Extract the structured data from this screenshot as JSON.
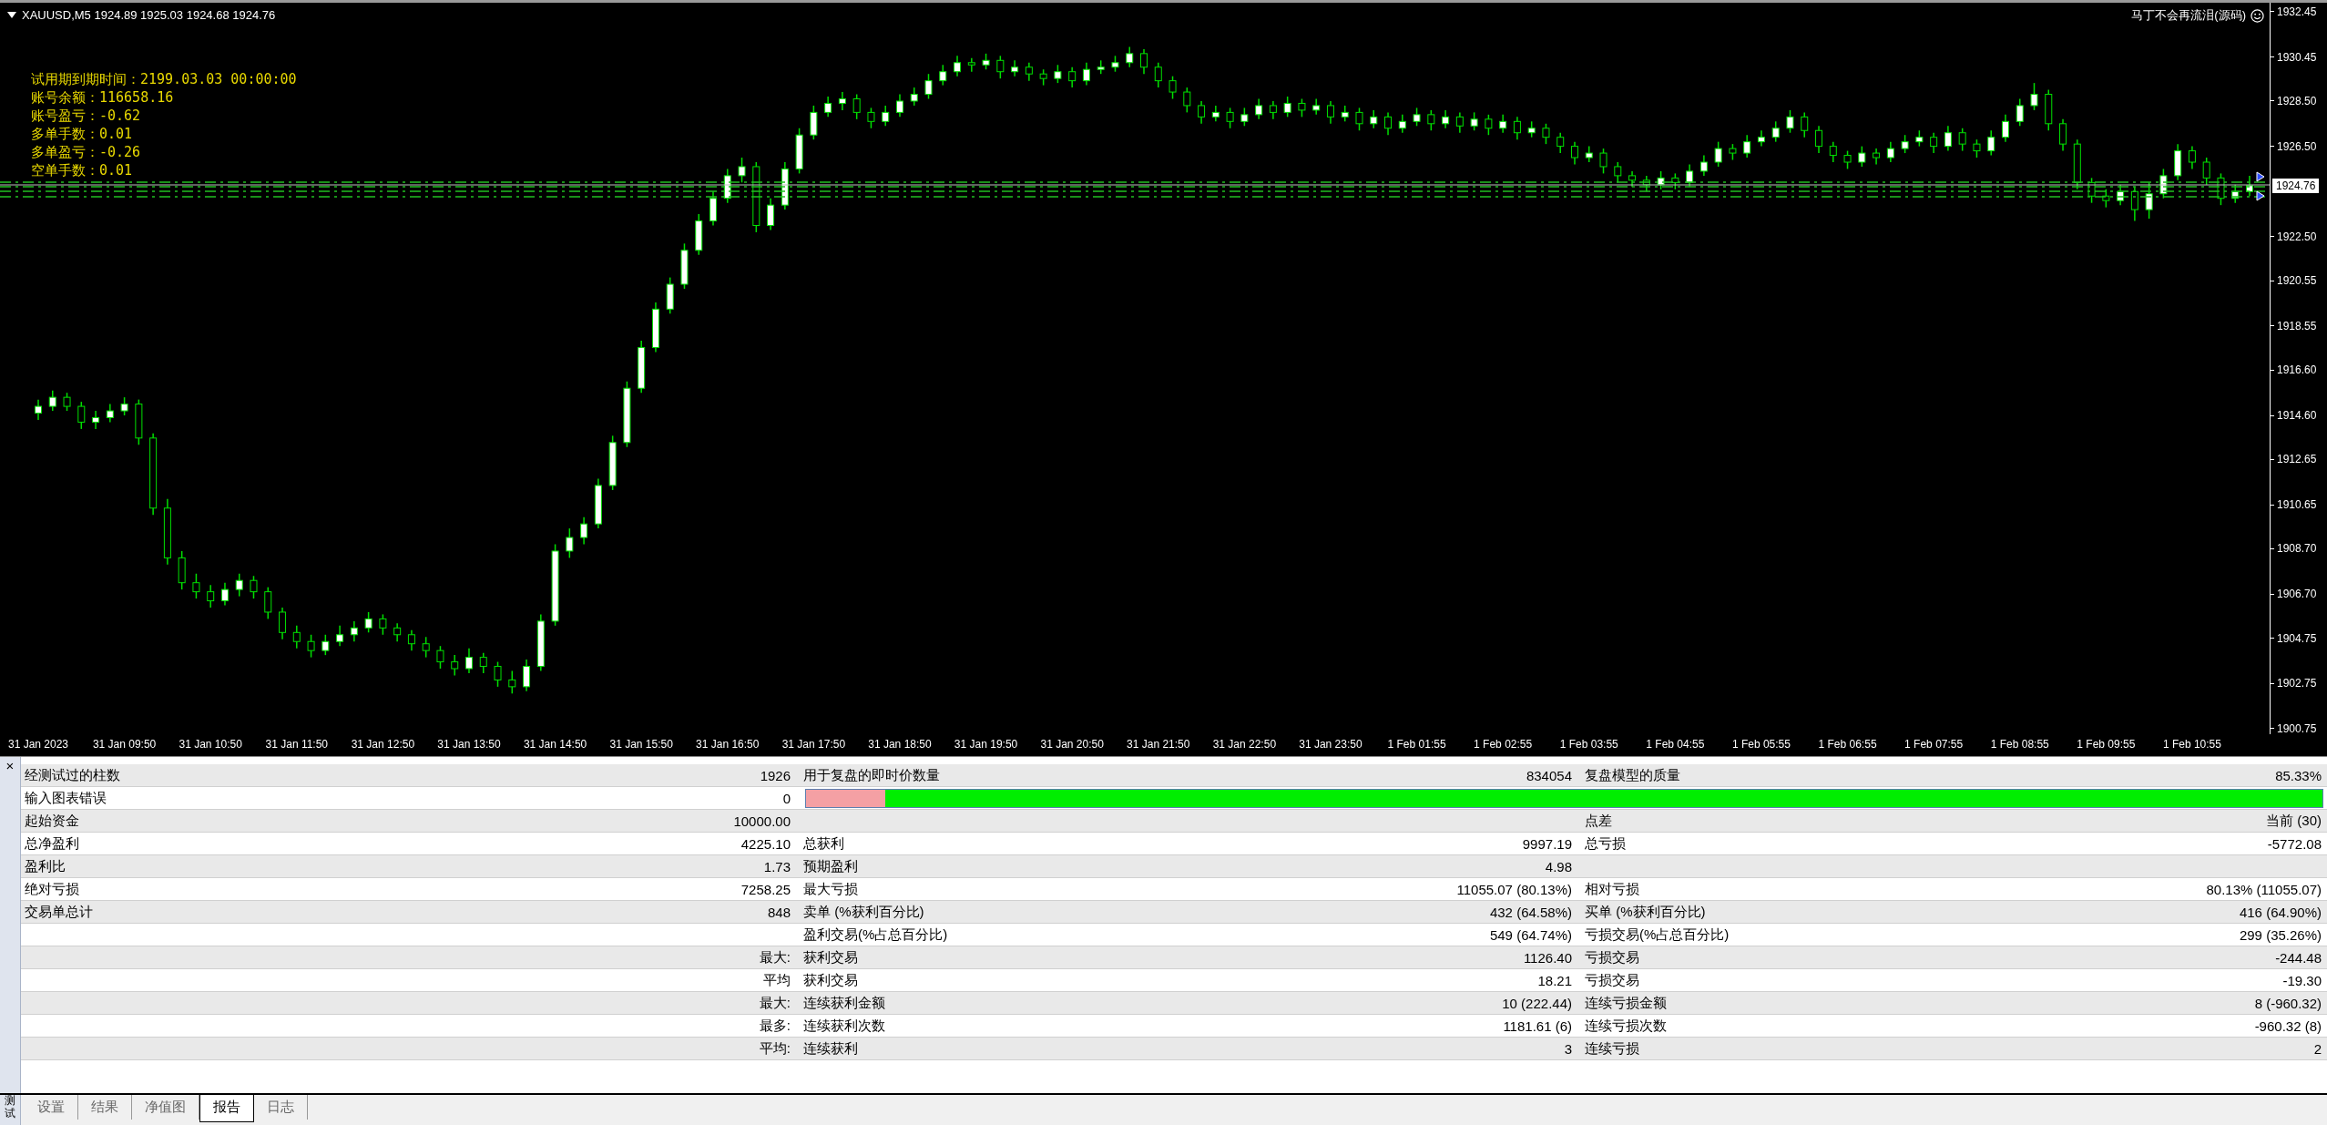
{
  "chart": {
    "symbol_info": "XAUUSD,M5  1924.89 1925.03 1924.68 1924.76",
    "indicator_title": "马丁不会再流泪(源码)",
    "info_lines": [
      "试用期到期时间：2199.03.03 00:00:00",
      "账号余额：116658.16",
      "账号盈亏：-0.62",
      "多单手数：0.01",
      "多单盈亏：-0.26",
      "空单手数：0.01"
    ],
    "current_price": "1924.76",
    "chart_data": {
      "type": "candlestick",
      "categories": [
        "31 Jan 2023",
        null,
        null,
        null,
        null,
        null,
        "31 Jan 09:50",
        null,
        null,
        null,
        null,
        null,
        "31 Jan 10:50",
        null,
        null,
        null,
        null,
        null,
        "31 Jan 11:50",
        null,
        null,
        null,
        null,
        null,
        "31 Jan 12:50",
        null,
        null,
        null,
        null,
        null,
        "31 Jan 13:50",
        null,
        null,
        null,
        null,
        null,
        "31 Jan 14:50",
        null,
        null,
        null,
        null,
        null,
        "31 Jan 15:50",
        null,
        null,
        null,
        null,
        null,
        "31 Jan 16:50",
        null,
        null,
        null,
        null,
        null,
        "31 Jan 17:50",
        null,
        null,
        null,
        null,
        null,
        "31 Jan 18:50",
        null,
        null,
        null,
        null,
        null,
        "31 Jan 19:50",
        null,
        null,
        null,
        null,
        null,
        "31 Jan 20:50",
        null,
        null,
        null,
        null,
        null,
        "31 Jan 21:50",
        null,
        null,
        null,
        null,
        null,
        "31 Jan 22:50",
        null,
        null,
        null,
        null,
        null,
        "31 Jan 23:50",
        null,
        null,
        null,
        null,
        null,
        "1 Feb 01:55",
        null,
        null,
        null,
        null,
        null,
        "1 Feb 02:55",
        null,
        null,
        null,
        null,
        null,
        "1 Feb 03:55",
        null,
        null,
        null,
        null,
        null,
        "1 Feb 04:55",
        null,
        null,
        null,
        null,
        null,
        "1 Feb 05:55",
        null,
        null,
        null,
        null,
        null,
        "1 Feb 06:55",
        null,
        null,
        null,
        null,
        null,
        "1 Feb 07:55",
        null,
        null,
        null,
        null,
        null,
        "1 Feb 08:55",
        null,
        null,
        null,
        null,
        null,
        "1 Feb 09:55",
        null,
        null,
        null,
        null,
        null,
        "1 Feb 10:55",
        null,
        null,
        null,
        null
      ],
      "ohlc": [
        [
          1914.7,
          1915.3,
          1914.4,
          1915.0
        ],
        [
          1915.0,
          1915.7,
          1914.8,
          1915.4
        ],
        [
          1915.4,
          1915.6,
          1914.8,
          1915.0
        ],
        [
          1915.0,
          1915.2,
          1914.0,
          1914.3
        ],
        [
          1914.3,
          1914.8,
          1914.0,
          1914.5
        ],
        [
          1914.5,
          1915.1,
          1914.3,
          1914.8
        ],
        [
          1914.8,
          1915.4,
          1914.6,
          1915.1
        ],
        [
          1915.1,
          1915.3,
          1913.3,
          1913.6
        ],
        [
          1913.6,
          1913.8,
          1910.2,
          1910.5
        ],
        [
          1910.5,
          1910.9,
          1908.0,
          1908.3
        ],
        [
          1908.3,
          1908.6,
          1906.9,
          1907.2
        ],
        [
          1907.2,
          1907.6,
          1906.5,
          1906.8
        ],
        [
          1906.8,
          1907.1,
          1906.1,
          1906.4
        ],
        [
          1906.4,
          1907.2,
          1906.2,
          1906.9
        ],
        [
          1906.9,
          1907.6,
          1906.6,
          1907.3
        ],
        [
          1907.3,
          1907.5,
          1906.5,
          1906.8
        ],
        [
          1906.8,
          1907.0,
          1905.6,
          1905.9
        ],
        [
          1905.9,
          1906.1,
          1904.7,
          1905.0
        ],
        [
          1905.0,
          1905.3,
          1904.3,
          1904.6
        ],
        [
          1904.6,
          1904.9,
          1903.9,
          1904.2
        ],
        [
          1904.2,
          1904.9,
          1904.0,
          1904.6
        ],
        [
          1904.6,
          1905.3,
          1904.4,
          1904.9
        ],
        [
          1904.9,
          1905.5,
          1904.6,
          1905.2
        ],
        [
          1905.2,
          1905.9,
          1905.0,
          1905.6
        ],
        [
          1905.6,
          1905.8,
          1904.9,
          1905.2
        ],
        [
          1905.2,
          1905.4,
          1904.6,
          1904.9
        ],
        [
          1904.9,
          1905.1,
          1904.2,
          1904.5
        ],
        [
          1904.5,
          1904.8,
          1903.9,
          1904.2
        ],
        [
          1904.2,
          1904.4,
          1903.4,
          1903.7
        ],
        [
          1903.7,
          1904.0,
          1903.1,
          1903.4
        ],
        [
          1903.4,
          1904.3,
          1903.2,
          1903.9
        ],
        [
          1903.9,
          1904.1,
          1903.2,
          1903.5
        ],
        [
          1903.5,
          1903.7,
          1902.6,
          1902.9
        ],
        [
          1902.9,
          1903.3,
          1902.3,
          1902.6
        ],
        [
          1902.6,
          1903.8,
          1902.4,
          1903.5
        ],
        [
          1903.5,
          1905.8,
          1903.3,
          1905.5
        ],
        [
          1905.5,
          1908.9,
          1905.3,
          1908.6
        ],
        [
          1908.6,
          1909.6,
          1908.3,
          1909.2
        ],
        [
          1909.2,
          1910.1,
          1908.9,
          1909.8
        ],
        [
          1909.8,
          1911.8,
          1909.6,
          1911.5
        ],
        [
          1911.5,
          1913.7,
          1911.3,
          1913.4
        ],
        [
          1913.4,
          1916.1,
          1913.2,
          1915.8
        ],
        [
          1915.8,
          1917.9,
          1915.6,
          1917.6
        ],
        [
          1917.6,
          1919.6,
          1917.4,
          1919.3
        ],
        [
          1919.3,
          1920.7,
          1919.1,
          1920.4
        ],
        [
          1920.4,
          1922.2,
          1920.2,
          1921.9
        ],
        [
          1921.9,
          1923.5,
          1921.7,
          1923.2
        ],
        [
          1923.2,
          1924.5,
          1923.0,
          1924.2
        ],
        [
          1924.2,
          1925.5,
          1924.0,
          1925.2
        ],
        [
          1925.2,
          1926.0,
          1924.9,
          1925.6
        ],
        [
          1925.6,
          1925.8,
          1922.7,
          1923.0
        ],
        [
          1923.0,
          1924.2,
          1922.8,
          1923.9
        ],
        [
          1923.9,
          1925.8,
          1923.7,
          1925.5
        ],
        [
          1925.5,
          1927.3,
          1925.3,
          1927.0
        ],
        [
          1927.0,
          1928.3,
          1926.8,
          1928.0
        ],
        [
          1928.0,
          1928.7,
          1927.8,
          1928.4
        ],
        [
          1928.4,
          1928.9,
          1928.1,
          1928.6
        ],
        [
          1928.6,
          1928.8,
          1927.7,
          1928.0
        ],
        [
          1928.0,
          1928.2,
          1927.3,
          1927.6
        ],
        [
          1927.6,
          1928.3,
          1927.4,
          1928.0
        ],
        [
          1928.0,
          1928.8,
          1927.8,
          1928.5
        ],
        [
          1928.5,
          1929.1,
          1928.3,
          1928.8
        ],
        [
          1928.8,
          1929.7,
          1928.6,
          1929.4
        ],
        [
          1929.4,
          1930.1,
          1929.2,
          1929.8
        ],
        [
          1929.8,
          1930.5,
          1929.6,
          1930.2
        ],
        [
          1930.2,
          1930.4,
          1929.8,
          1930.1
        ],
        [
          1930.1,
          1930.6,
          1929.9,
          1930.3
        ],
        [
          1930.3,
          1930.5,
          1929.5,
          1929.8
        ],
        [
          1929.8,
          1930.3,
          1929.6,
          1930.0
        ],
        [
          1930.0,
          1930.2,
          1929.4,
          1929.7
        ],
        [
          1929.7,
          1929.9,
          1929.2,
          1929.5
        ],
        [
          1929.5,
          1930.1,
          1929.3,
          1929.8
        ],
        [
          1929.8,
          1930.0,
          1929.1,
          1929.4
        ],
        [
          1929.4,
          1930.2,
          1929.2,
          1929.9
        ],
        [
          1929.9,
          1930.3,
          1929.7,
          1930.0
        ],
        [
          1930.0,
          1930.5,
          1929.8,
          1930.2
        ],
        [
          1930.2,
          1930.9,
          1930.0,
          1930.6
        ],
        [
          1930.6,
          1930.8,
          1929.7,
          1930.0
        ],
        [
          1930.0,
          1930.2,
          1929.1,
          1929.4
        ],
        [
          1929.4,
          1929.6,
          1928.6,
          1928.9
        ],
        [
          1928.9,
          1929.1,
          1928.0,
          1928.3
        ],
        [
          1928.3,
          1928.5,
          1927.5,
          1927.8
        ],
        [
          1927.8,
          1928.3,
          1927.6,
          1928.0
        ],
        [
          1928.0,
          1928.2,
          1927.3,
          1927.6
        ],
        [
          1927.6,
          1928.2,
          1927.4,
          1927.9
        ],
        [
          1927.9,
          1928.6,
          1927.7,
          1928.3
        ],
        [
          1928.3,
          1928.5,
          1927.7,
          1928.0
        ],
        [
          1928.0,
          1928.7,
          1927.8,
          1928.4
        ],
        [
          1928.4,
          1928.6,
          1927.8,
          1928.1
        ],
        [
          1928.1,
          1928.6,
          1927.9,
          1928.3
        ],
        [
          1928.3,
          1928.5,
          1927.5,
          1927.8
        ],
        [
          1927.8,
          1928.3,
          1927.6,
          1928.0
        ],
        [
          1928.0,
          1928.2,
          1927.2,
          1927.5
        ],
        [
          1927.5,
          1928.1,
          1927.3,
          1927.8
        ],
        [
          1927.8,
          1928.0,
          1927.0,
          1927.3
        ],
        [
          1927.3,
          1927.9,
          1927.1,
          1927.6
        ],
        [
          1927.6,
          1928.2,
          1927.4,
          1927.9
        ],
        [
          1927.9,
          1928.1,
          1927.2,
          1927.5
        ],
        [
          1927.5,
          1928.1,
          1927.3,
          1927.8
        ],
        [
          1927.8,
          1928.0,
          1927.1,
          1927.4
        ],
        [
          1927.4,
          1928.0,
          1927.2,
          1927.7
        ],
        [
          1927.7,
          1927.9,
          1927.0,
          1927.3
        ],
        [
          1927.3,
          1927.9,
          1927.1,
          1927.6
        ],
        [
          1927.6,
          1927.8,
          1926.8,
          1927.1
        ],
        [
          1927.1,
          1927.6,
          1926.9,
          1927.3
        ],
        [
          1927.3,
          1927.5,
          1926.6,
          1926.9
        ],
        [
          1926.9,
          1927.1,
          1926.2,
          1926.5
        ],
        [
          1926.5,
          1926.7,
          1925.7,
          1926.0
        ],
        [
          1926.0,
          1926.5,
          1925.8,
          1926.2
        ],
        [
          1926.2,
          1926.4,
          1925.3,
          1925.6
        ],
        [
          1925.6,
          1925.8,
          1924.9,
          1925.2
        ],
        [
          1925.2,
          1925.4,
          1924.7,
          1925.0
        ],
        [
          1925.0,
          1925.2,
          1924.5,
          1924.8
        ],
        [
          1924.8,
          1925.4,
          1924.6,
          1925.1
        ],
        [
          1925.1,
          1925.3,
          1924.6,
          1924.9
        ],
        [
          1924.9,
          1925.7,
          1924.7,
          1925.4
        ],
        [
          1925.4,
          1926.1,
          1925.2,
          1925.8
        ],
        [
          1925.8,
          1926.7,
          1925.6,
          1926.4
        ],
        [
          1926.4,
          1926.6,
          1925.9,
          1926.2
        ],
        [
          1926.2,
          1927.0,
          1926.0,
          1926.7
        ],
        [
          1926.7,
          1927.2,
          1926.5,
          1926.9
        ],
        [
          1926.9,
          1927.6,
          1926.7,
          1927.3
        ],
        [
          1927.3,
          1928.1,
          1927.1,
          1927.8
        ],
        [
          1927.8,
          1928.0,
          1926.9,
          1927.2
        ],
        [
          1927.2,
          1927.4,
          1926.2,
          1926.5
        ],
        [
          1926.5,
          1926.7,
          1925.8,
          1926.1
        ],
        [
          1926.1,
          1926.3,
          1925.5,
          1925.8
        ],
        [
          1925.8,
          1926.5,
          1925.6,
          1926.2
        ],
        [
          1926.2,
          1926.4,
          1925.7,
          1926.0
        ],
        [
          1926.0,
          1926.7,
          1925.8,
          1926.4
        ],
        [
          1926.4,
          1927.0,
          1926.2,
          1926.7
        ],
        [
          1926.7,
          1927.2,
          1926.5,
          1926.9
        ],
        [
          1926.9,
          1927.1,
          1926.2,
          1926.5
        ],
        [
          1926.5,
          1927.4,
          1926.3,
          1927.1
        ],
        [
          1927.1,
          1927.3,
          1926.3,
          1926.6
        ],
        [
          1926.6,
          1926.8,
          1926.0,
          1926.3
        ],
        [
          1926.3,
          1927.2,
          1926.1,
          1926.9
        ],
        [
          1926.9,
          1927.9,
          1926.7,
          1927.6
        ],
        [
          1927.6,
          1928.6,
          1927.4,
          1928.3
        ],
        [
          1928.3,
          1929.3,
          1928.1,
          1928.8
        ],
        [
          1928.8,
          1929.0,
          1927.2,
          1927.5
        ],
        [
          1927.5,
          1927.7,
          1926.3,
          1926.6
        ],
        [
          1926.6,
          1926.8,
          1924.6,
          1924.9
        ],
        [
          1924.9,
          1925.1,
          1924.0,
          1924.3
        ],
        [
          1924.3,
          1924.6,
          1923.8,
          1924.1
        ],
        [
          1924.1,
          1924.8,
          1923.9,
          1924.5
        ],
        [
          1924.5,
          1924.7,
          1923.2,
          1923.7
        ],
        [
          1923.7,
          1924.9,
          1923.3,
          1924.4
        ],
        [
          1924.4,
          1925.5,
          1924.2,
          1925.2
        ],
        [
          1925.2,
          1926.6,
          1925.0,
          1926.3
        ],
        [
          1926.3,
          1926.5,
          1925.5,
          1925.8
        ],
        [
          1925.8,
          1926.0,
          1924.8,
          1925.1
        ],
        [
          1925.1,
          1925.3,
          1923.9,
          1924.2
        ],
        [
          1924.2,
          1924.8,
          1924.0,
          1924.5
        ],
        [
          1924.5,
          1925.2,
          1924.3,
          1924.76
        ]
      ],
      "ylim": [
        1900.5,
        1932.85
      ],
      "yticks": [
        {
          "value": 1932.45,
          "label": "1932.45"
        },
        {
          "value": 1930.45,
          "label": "1930.45"
        },
        {
          "value": 1928.5,
          "label": "1928.50"
        },
        {
          "value": 1926.5,
          "label": "1926.50"
        },
        {
          "value": 1922.5,
          "label": "1922.50"
        },
        {
          "value": 1920.55,
          "label": "1920.55"
        },
        {
          "value": 1918.55,
          "label": "1918.55"
        },
        {
          "value": 1916.6,
          "label": "1916.60"
        },
        {
          "value": 1914.6,
          "label": "1914.60"
        },
        {
          "value": 1912.65,
          "label": "1912.65"
        },
        {
          "value": 1910.65,
          "label": "1910.65"
        },
        {
          "value": 1908.7,
          "label": "1908.70"
        },
        {
          "value": 1906.7,
          "label": "1906.70"
        },
        {
          "value": 1904.75,
          "label": "1904.75"
        },
        {
          "value": 1902.75,
          "label": "1902.75"
        },
        {
          "value": 1900.75,
          "label": "1900.75"
        }
      ]
    }
  },
  "report": {
    "close": "×",
    "rows": [
      {
        "kind": "text",
        "label_1": "经测试过的柱数",
        "value_1": "1926",
        "label_2": "用于复盘的即时价数量",
        "value_2": "834054",
        "label_3": "复盘模型的质量",
        "value_3": "85.33%"
      },
      {
        "kind": "quality_bar",
        "label_1": "输入图表错误",
        "value_1": "0",
        "level": 0.948
      },
      {
        "kind": "text",
        "label_1": "起始资金",
        "value_1": "10000.00",
        "label_3": "点差",
        "value_3": "当前 (30)"
      },
      {
        "kind": "text",
        "label_1": "总净盈利",
        "value_1": "4225.10",
        "label_2": "总获利",
        "value_2": "9997.19",
        "label_3": "总亏损",
        "value_3": "-5772.08"
      },
      {
        "kind": "text",
        "label_1": "盈利比",
        "value_1": "1.73",
        "label_2": "预期盈利",
        "value_2": "4.98"
      },
      {
        "kind": "text",
        "label_1": "绝对亏损",
        "value_1": "7258.25",
        "label_2": "最大亏损",
        "value_2": "11055.07 (80.13%)",
        "label_3": "相对亏损",
        "value_3": "80.13% (11055.07)"
      },
      {
        "kind": "text",
        "label_1": "交易单总计",
        "value_1": "848",
        "label_2": "卖单 (%获利百分比)",
        "value_2": "432 (64.58%)",
        "label_3": "买单 (%获利百分比)",
        "value_3": "416 (64.90%)"
      },
      {
        "kind": "text",
        "label_2": "盈利交易(%占总百分比)",
        "value_2": "549 (64.74%)",
        "label_3": "亏损交易(%占总百分比)",
        "value_3": "299 (35.26%)"
      },
      {
        "kind": "text",
        "value_1": "最大:",
        "label_2": "获利交易",
        "value_2": "1126.40",
        "label_3": "亏损交易",
        "value_3": "-244.48"
      },
      {
        "kind": "text",
        "value_1": "平均",
        "label_2": "获利交易",
        "value_2": "18.21",
        "label_3": "亏损交易",
        "value_3": "-19.30"
      },
      {
        "kind": "text",
        "value_1": "最大:",
        "label_2": "连续获利金额",
        "value_2": "10 (222.44)",
        "label_3": "连续亏损金额",
        "value_3": "8 (-960.32)"
      },
      {
        "kind": "text",
        "value_1": "最多:",
        "label_2": "连续获利次数",
        "value_2": "1181.61 (6)",
        "label_3": "连续亏损次数",
        "value_3": "-960.32 (8)"
      },
      {
        "kind": "text",
        "value_1": "平均:",
        "label_2": "连续获利",
        "value_2": "3",
        "label_3": "连续亏损",
        "value_3": "2"
      }
    ]
  },
  "side_label": "测试",
  "tabs": [
    {
      "label": "设置",
      "selected": false
    },
    {
      "label": "结果",
      "selected": false
    },
    {
      "label": "净值图",
      "selected": false
    },
    {
      "label": "报告",
      "selected": true
    },
    {
      "label": "日志",
      "selected": false
    }
  ]
}
